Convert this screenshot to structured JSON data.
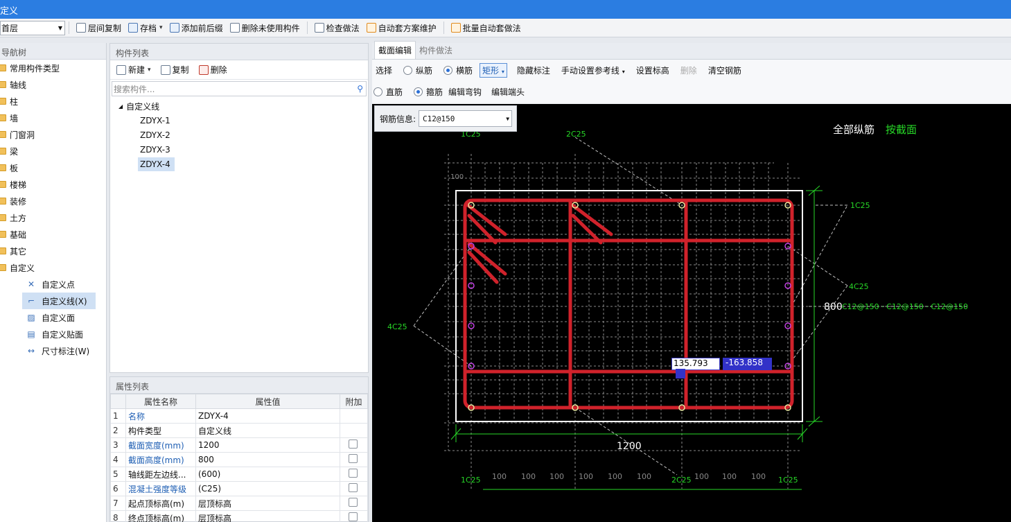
{
  "window": {
    "title": "定义"
  },
  "toolbar": {
    "floor": "首层",
    "buttons": [
      "层间复制",
      "存档",
      "添加前后缀",
      "删除未使用构件",
      "检查做法",
      "自动套方案维护",
      "批量自动套做法"
    ]
  },
  "nav": {
    "title": "导航树",
    "items": [
      "常用构件类型",
      "轴线",
      "柱",
      "墙",
      "门窗洞",
      "梁",
      "板",
      "楼梯",
      "装修",
      "土方",
      "基础",
      "其它",
      "自定义"
    ],
    "sub_items": [
      "自定义点",
      "自定义线(X)",
      "自定义面",
      "自定义贴面",
      "尺寸标注(W)"
    ]
  },
  "component_list": {
    "title": "构件列表",
    "new_label": "新建",
    "copy_label": "复制",
    "delete_label": "删除",
    "search_placeholder": "搜索构件...",
    "root": "自定义线",
    "items": [
      "ZDYX-1",
      "ZDYX-2",
      "ZDYX-3",
      "ZDYX-4"
    ]
  },
  "properties": {
    "title": "属性列表",
    "headers": [
      "属性名称",
      "属性值",
      "附加"
    ],
    "rows": [
      {
        "n": "1",
        "name": "名称",
        "value": "ZDYX-4"
      },
      {
        "n": "2",
        "name": "构件类型",
        "value": "自定义线"
      },
      {
        "n": "3",
        "name": "截面宽度(mm)",
        "value": "1200"
      },
      {
        "n": "4",
        "name": "截面高度(mm)",
        "value": "800"
      },
      {
        "n": "5",
        "name": "轴线距左边线...",
        "value": "(600)"
      },
      {
        "n": "6",
        "name": "混凝土强度等级",
        "value": "(C25)"
      },
      {
        "n": "7",
        "name": "起点顶标高(m)",
        "value": "层顶标高"
      },
      {
        "n": "8",
        "name": "终点顶标高(m)",
        "value": "层顶标高"
      }
    ]
  },
  "editor": {
    "tabs": [
      "截面编辑",
      "构件做法"
    ],
    "row1": {
      "select": "选择",
      "longitudinal": "纵筋",
      "transverse": "横筋",
      "shape": "矩形",
      "hide_mark": "隐藏标注",
      "manual_ref": "手动设置参考线",
      "set_elev": "设置标高",
      "delete": "删除",
      "clear": "清空钢筋"
    },
    "row2": {
      "straight": "直筋",
      "stirrup": "箍筋",
      "edit_hook": "编辑弯钩",
      "edit_end": "编辑端头"
    },
    "rebar_info_label": "钢筋信息:",
    "rebar_info_value": "C12@150"
  },
  "drawing": {
    "width_label": "1200",
    "height_label": "800",
    "all_long_bars": "全部纵筋",
    "by_section": "按截面",
    "top_right": "1C25",
    "top_left": "1C25",
    "top_mid": "2C25",
    "left_side": "4C25",
    "right_side": "4C25",
    "stirrups": "C12@150 · C12@150 · C12@150",
    "bottom_left": "1C25",
    "bottom_mid": "2C25",
    "bottom_right": "1C25",
    "grid_step": "100",
    "coord_x": "135.793",
    "coord_y": "-163.858"
  },
  "colors": {
    "title_bar": "#2b7de1",
    "rebar": "#d0222b",
    "dim": "#27d827",
    "canvas": "#000000"
  }
}
